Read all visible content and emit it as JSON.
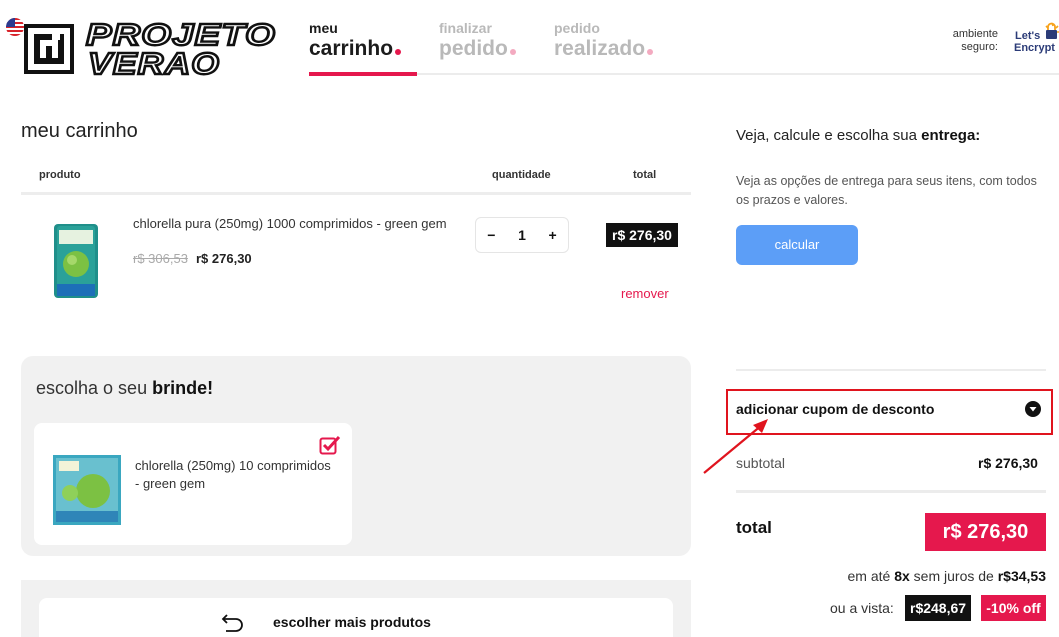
{
  "header": {
    "brand_line1": "PROJETO",
    "brand_line2": "VERAO",
    "steps": [
      {
        "small": "meu",
        "big": "carrinho",
        "state": "active"
      },
      {
        "small": "finalizar",
        "big": "pedido",
        "state": "inactive"
      },
      {
        "small": "pedido",
        "big": "realizado",
        "state": "inactive"
      }
    ],
    "secure_line1": "ambiente",
    "secure_line2": "seguro:",
    "ssl_brand_line1": "Let's",
    "ssl_brand_line2": "Encrypt"
  },
  "cart": {
    "title": "meu carrinho",
    "columns": {
      "product": "produto",
      "quantity": "quantidade",
      "total": "total"
    },
    "items": [
      {
        "name": "chlorella pura (250mg) 1000 comprimidos - green gem",
        "old_price": "r$ 306,53",
        "price": "r$ 276,30",
        "quantity": "1",
        "minus": "−",
        "plus": "+",
        "total": "r$ 276,30",
        "remove": "remover"
      }
    ]
  },
  "gift": {
    "title_prefix": "escolha o seu",
    "title_bold": "brinde!",
    "item_name": "chlorella (250mg) 10 comprimidos - green gem",
    "checked": true
  },
  "more_products": {
    "label": "escolher mais produtos"
  },
  "shipping": {
    "title_prefix": "Veja, calcule e escolha sua",
    "title_bold": "entrega:",
    "description": "Veja as opções de entrega para seus itens, com todos os prazos e valores.",
    "button": "calcular"
  },
  "summary": {
    "coupon_label": "adicionar cupom de desconto",
    "subtotal_label": "subtotal",
    "subtotal_value": "r$ 276,30",
    "total_label": "total",
    "total_value": "r$ 276,30",
    "installments_prefix": "em até",
    "installments_count": "8x",
    "installments_mid": "sem juros de",
    "installments_value": "r$34,53",
    "cash_label": "ou a vista:",
    "cash_price": "r$248,67",
    "cash_discount": "-10% off"
  },
  "colors": {
    "accent": "#e5184d",
    "button_blue": "#5c9ef7",
    "highlight_red": "#e0141e",
    "dark": "#111111",
    "panel_bg": "#f1f1f1"
  },
  "icons": {
    "flag": "us-flag-icon",
    "logo": "projeto-verao-logo",
    "ssl": "lets-encrypt-logo",
    "coupon_toggle": "chevron-down-circle-icon",
    "gift_check": "checkbox-checked-icon",
    "more_products": "return-arrow-icon",
    "annotation": "red-arrow-annotation"
  }
}
